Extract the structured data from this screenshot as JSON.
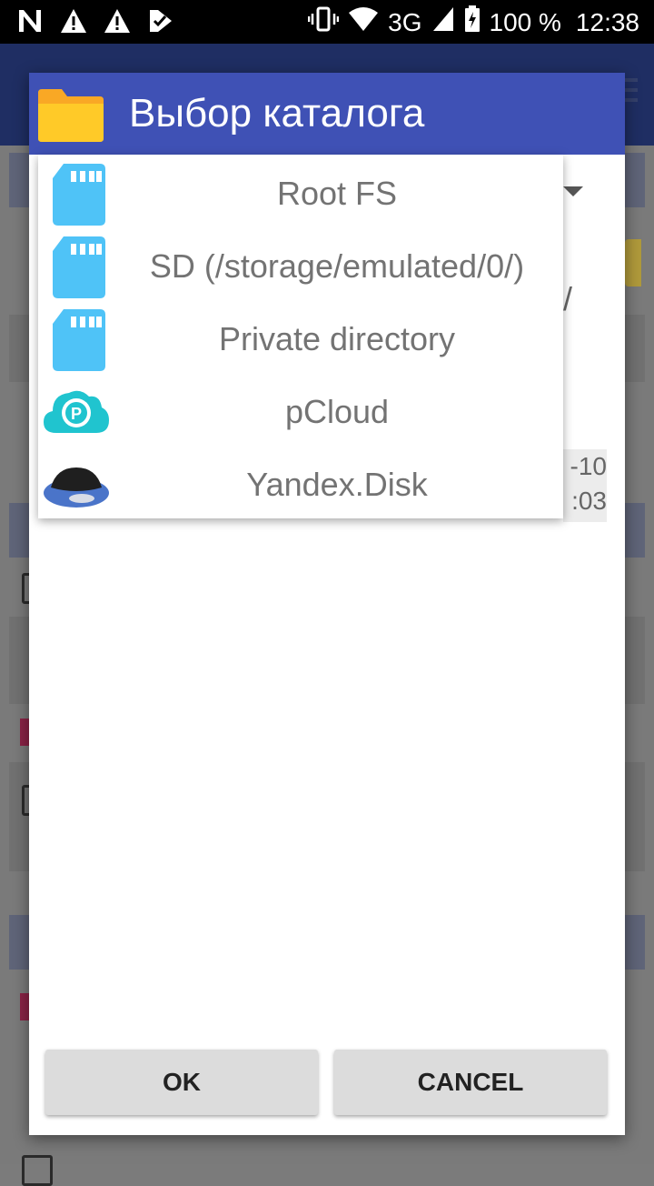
{
  "status_bar": {
    "network": "3G",
    "battery": "100 %",
    "time": "12:38"
  },
  "background": {
    "date_fragment_1": "-10",
    "date_fragment_2": ":03",
    "slash": "/"
  },
  "dialog": {
    "title": "Выбор каталога",
    "locations": [
      {
        "label": "Root FS",
        "icon": "sd-card-icon"
      },
      {
        "label": "SD (/storage/emulated/0/)",
        "icon": "sd-card-icon"
      },
      {
        "label": "Private directory",
        "icon": "sd-card-icon"
      },
      {
        "label": "pCloud",
        "icon": "pcloud-icon"
      },
      {
        "label": "Yandex.Disk",
        "icon": "yandex-disk-icon"
      }
    ],
    "ok_label": "OK",
    "cancel_label": "CANCEL"
  },
  "colors": {
    "header": "#3f51b5",
    "sd_icon": "#4fc3f7",
    "pcloud": "#20c4cf",
    "yandex_dome": "#1f1f1f",
    "yandex_rim": "#4a74c9"
  }
}
